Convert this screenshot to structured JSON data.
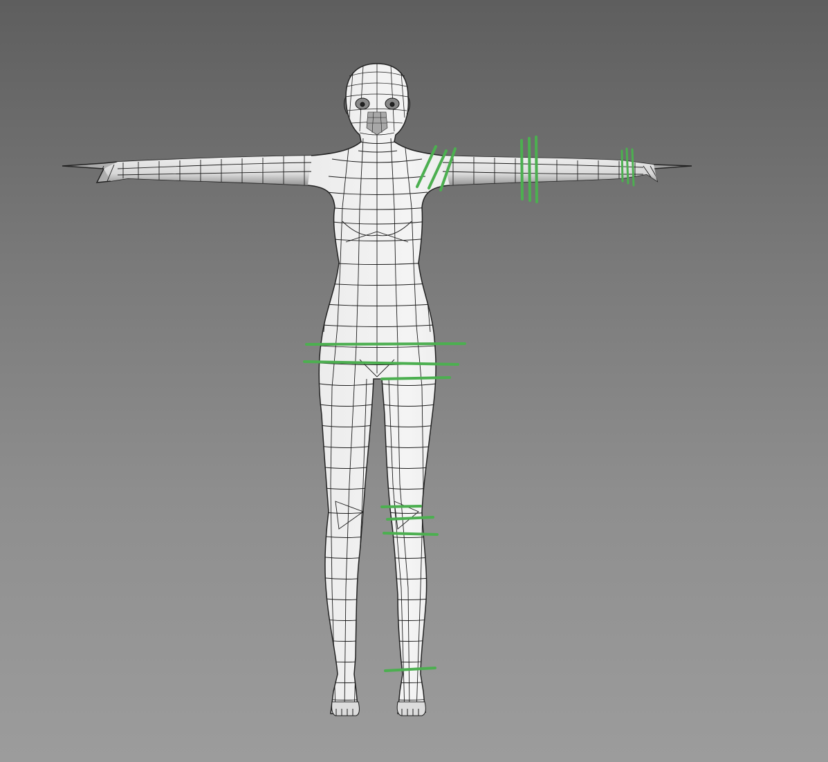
{
  "viewport": {
    "background_top": "#5e5e5e",
    "background_bottom": "#9c9c9c"
  },
  "model": {
    "shading": "wireframe-on-shaded",
    "pose": "T-pose",
    "surface_color": "#e8e8e8",
    "wire_color": "#1a1a1a"
  },
  "edge_loop_markers": {
    "color": "#4caf50",
    "groups": [
      "shoulder",
      "upper-arm",
      "wrist",
      "hip",
      "knee",
      "ankle"
    ]
  }
}
